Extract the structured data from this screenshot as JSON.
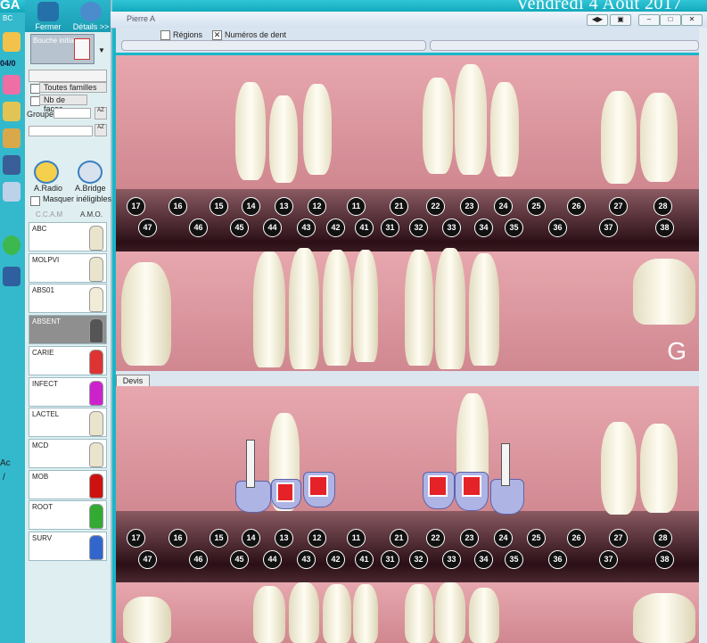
{
  "header": {
    "logo_text": "GA",
    "date": "Vendredi 4 Août 2017",
    "date_short": "04/0",
    "window_title": "Pierre A",
    "tab_frag": "BC"
  },
  "toolbar": {
    "fermer": "Fermer",
    "details": "Détails >>",
    "regions": "Régions",
    "numeros": "Numéros de dent"
  },
  "panel": {
    "view_select": "Bouche initiale",
    "toutes_familles": "Toutes familles",
    "nb_faces": "Nb de faces",
    "groupe_label": "Groupe:",
    "ccam": "C.C.A.M",
    "amo": "A.M.O.",
    "radio": "A.Radio",
    "bridge": "A.Bridge",
    "masquer": "Masquer inéligibles",
    "acts": [
      "ABC",
      "MOLPVI",
      "ABS01",
      "ABSENT",
      "CARIE",
      "INFECT",
      "LACTEL",
      "MCD",
      "MOB",
      "ROOT",
      "SURV"
    ]
  },
  "devis_tab": "Devis",
  "jaw_letter": "G",
  "left_frag": {
    "a": "Ac",
    "b": "/"
  },
  "teeth_upper_numbers": [
    "17",
    "16",
    "15",
    "14",
    "13",
    "12",
    "11",
    "21",
    "22",
    "23",
    "24",
    "25",
    "26",
    "27",
    "28"
  ],
  "teeth_lower_numbers": [
    "47",
    "46",
    "45",
    "44",
    "43",
    "42",
    "41",
    "31",
    "32",
    "33",
    "34",
    "35",
    "36",
    "37",
    "38"
  ],
  "colors": {
    "accent": "#1ab6c8",
    "gum": "#d98c95",
    "restoration": "#aeb4e4",
    "post": "#e52227"
  }
}
